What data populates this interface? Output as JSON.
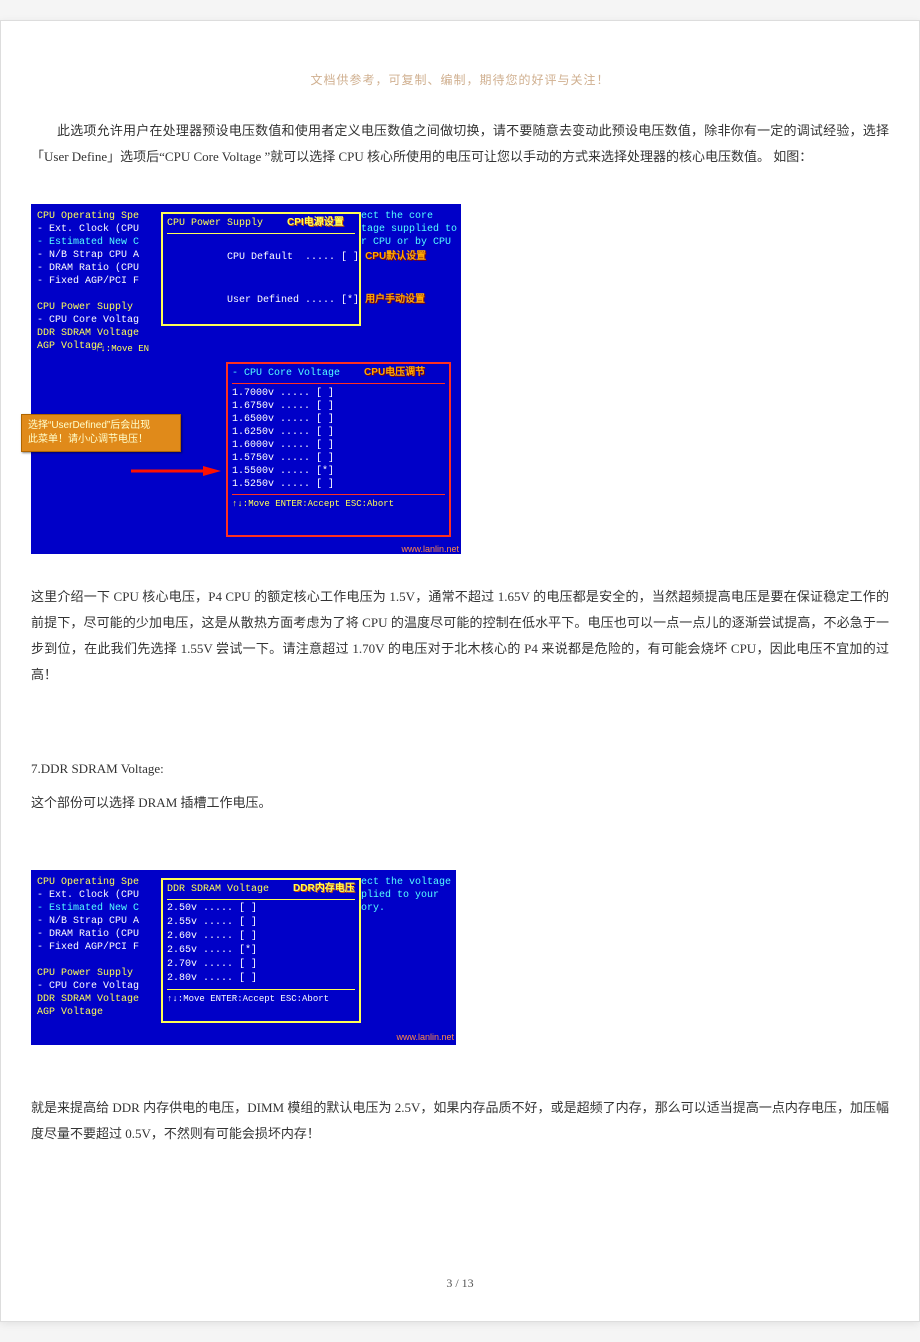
{
  "header_note": "文档供参考，可复制、编制，期待您的好评与关注！",
  "para1": "此选项允许用户在处理器预设电压数值和使用者定义电压数值之间做切换，请不要随意去变动此预设电压数值，除非你有一定的调试经验，选择「User Define」选项后“CPU Core Voltage ”就可以选择 CPU 核心所使用的电压可让您以手动的方式来选择处理器的核心电压数值。  如图：",
  "bios_left_items": [
    "CPU Operating Spe",
    "- Ext. Clock (CPU",
    "- Estimated New C",
    "- N/B Strap CPU A",
    "- DRAM Ratio (CPU",
    "- Fixed AGP/PCI F",
    "",
    "CPU Power Supply",
    "- CPU Core Voltag",
    "DDR SDRAM Voltage",
    "AGP Voltage"
  ],
  "bios1_right_items": [
    "ect the core",
    "tage supplied to",
    "r CPU or by CPU",
    ""
  ],
  "bios1_sub_title": "CPU Power Supply",
  "bios1_sub_title_cn": "CPI电源设置",
  "bios1_sub_options": [
    {
      "label": "CPU Default  ..... [ ]",
      "cn": "CPU默认设置"
    },
    {
      "label": "User Defined ..... [*]",
      "cn": "用户手动设置"
    }
  ],
  "bios1_red_title": "- CPU Core Voltage",
  "bios1_red_title_cn": "CPU电压调节",
  "bios1_red_options": [
    "1.7000v ..... [ ]",
    "1.6750v ..... [ ]",
    "1.6500v ..... [ ]",
    "1.6250v ..... [ ]",
    "1.6000v ..... [ ]",
    "1.5750v ..... [ ]",
    "1.5500v ..... [*]",
    "1.5250v ..... [ ]"
  ],
  "bios_move_hint": "↑↓:Move ENTER:Accept ESC:Abort",
  "bios_move_short": "↑↓:Move EN",
  "bios1_callout_l1": "选择“UserDefined”后会出现",
  "bios1_callout_l2": "此菜单！请小心调节电压！",
  "watermark": "www.lanlin.net",
  "para2": "这里介绍一下 CPU 核心电压，P4 CPU 的额定核心工作电压为 1.5V，通常不超过 1.65V 的电压都是安全的，当然超频提高电压是要在保证稳定工作的前提下，尽可能的少加电压，这是从散热方面考虑为了将 CPU 的温度尽可能的控制在低水平下。电压也可以一点一点儿的逐渐尝试提高，不必急于一步到位，在此我们先选择 1.55V 尝试一下。请注意超过 1.70V 的电压对于北木核心的 P4 来说都是危险的，有可能会烧坏 CPU，因此电压不宜加的过高！",
  "sec7_title": "7.DDR SDRAM Voltage:",
  "sec7_sub": "这个部份可以选择 DRAM 插槽工作电压。",
  "bios2_right_items": [
    "ect the voltage",
    "plied to your",
    "ory."
  ],
  "bios2_sub_title": "DDR SDRAM Voltage",
  "bios2_sub_title_cn": "DDR内存电压",
  "bios2_sub_options": [
    "2.50v ..... [ ]",
    "2.55v ..... [ ]",
    "2.60v ..... [ ]",
    "2.65v ..... [*]",
    "2.70v ..... [ ]",
    "2.80v ..... [ ]"
  ],
  "para3": "就是来提高给 DDR 内存供电的电压，DIMM 模组的默认电压为 2.5V，如果内存品质不好，或是超频了内存，那么可以适当提高一点内存电压，加压幅度尽量不要超过 0.5V，不然则有可能会损坏内存！",
  "page_num": "3  / 13"
}
